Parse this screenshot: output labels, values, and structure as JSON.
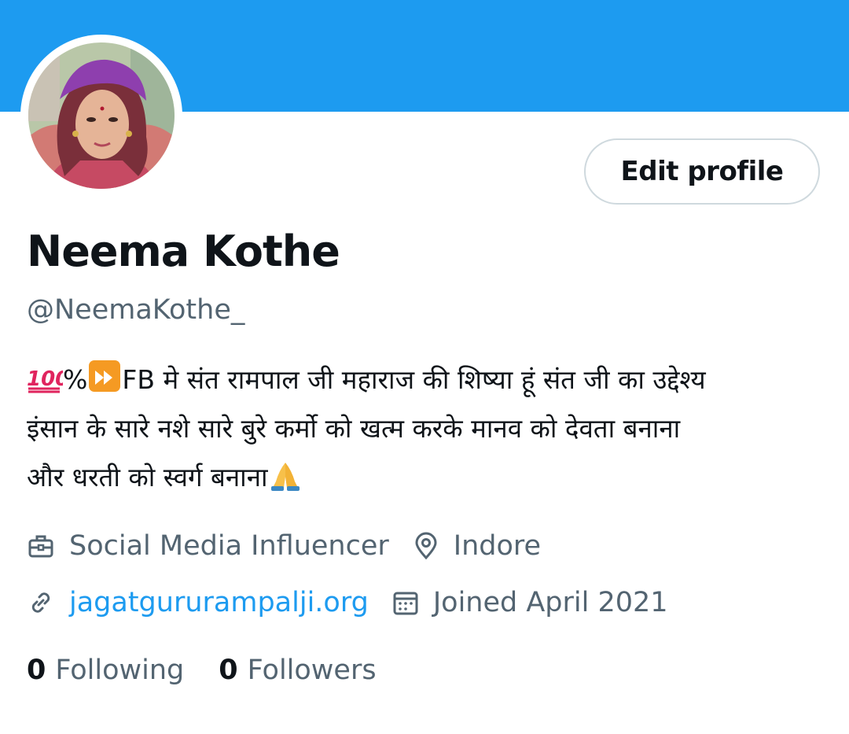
{
  "colors": {
    "banner": "#1d9bf0",
    "link": "#1d9bf0",
    "secondary_text": "#536471",
    "primary_text": "#0f1419",
    "border": "#cfd9de"
  },
  "profile": {
    "display_name": "Neema Kothe",
    "handle": "@NeemaKothe_",
    "edit_button_label": "Edit profile",
    "avatar_icon": "profile-photo",
    "bio": {
      "line1_percent": "%",
      "line1_text": "FB मे संत रामपाल जी महाराज की शिष्या हूं संत जी का उद्देश्य",
      "line2_text": "इंसान के सारे नशे सारे बुरे कर्मो को खत्म करके मानव को देवता बनाना",
      "line3_text": "और धरती को स्वर्ग बनाना",
      "emojis": [
        "hundred-points-emoji",
        "fast-forward-emoji",
        "folded-hands-emoji"
      ]
    },
    "profession": "Social Media Influencer",
    "location": "Indore",
    "website": "jagatgururampalji.org",
    "joined": "Joined April 2021",
    "following_count": "0",
    "following_label": "Following",
    "followers_count": "0",
    "followers_label": "Followers"
  }
}
